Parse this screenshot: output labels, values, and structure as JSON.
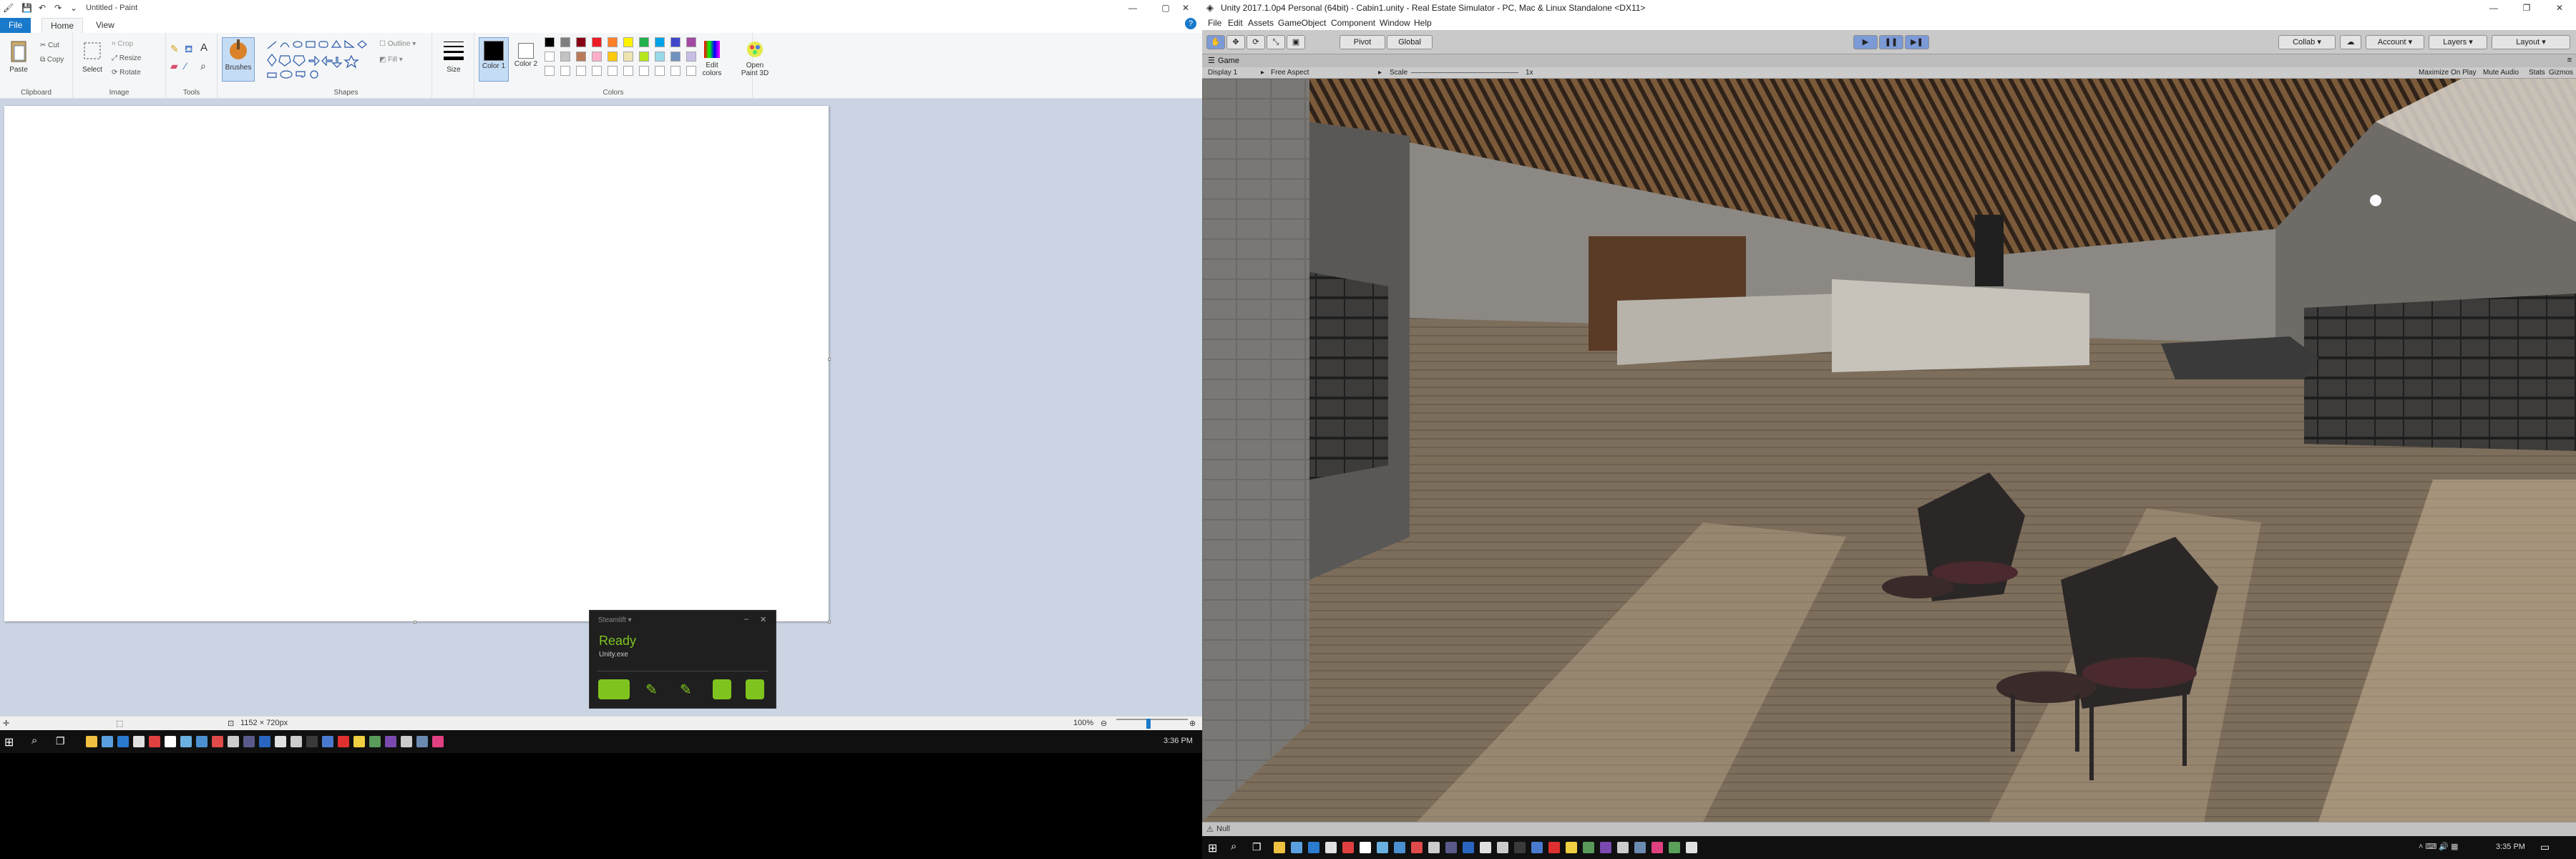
{
  "paint": {
    "title": "Untitled - Paint",
    "tabs": [
      "File",
      "Home",
      "View"
    ],
    "clipboard": {
      "paste": "Paste",
      "cut": "Cut",
      "copy": "Copy",
      "group": "Clipboard"
    },
    "image": {
      "select": "Select",
      "crop": "Crop",
      "resize": "Resize",
      "rotate": "Rotate",
      "group": "Image"
    },
    "tools": {
      "group": "Tools"
    },
    "brushes": {
      "label": "Brushes"
    },
    "shapes": {
      "outline": "Outline",
      "fill": "Fill",
      "group": "Shapes"
    },
    "size": {
      "label": "Size"
    },
    "colors": {
      "color1": "Color 1",
      "color2": "Color 2",
      "edit": "Edit colors",
      "group": "Colors",
      "row1": [
        "#000000",
        "#7f7f7f",
        "#880015",
        "#ed1c24",
        "#ff7f27",
        "#fff200",
        "#22b14c",
        "#00a2e8",
        "#3f48cc",
        "#a349a4"
      ],
      "row2": [
        "#ffffff",
        "#c3c3c3",
        "#b97a57",
        "#ffaec9",
        "#ffc90e",
        "#efe4b0",
        "#b5e61d",
        "#99d9ea",
        "#7092be",
        "#c8bfe7"
      ]
    },
    "paint3d": "Open Paint 3D",
    "status": {
      "canvas_size": "1152 × 720px",
      "zoom": "100%"
    }
  },
  "steamlift": {
    "header": "Steamlift ▾",
    "status": "Ready",
    "process": "Unity.exe"
  },
  "taskbar_left": {
    "clock": "3:36 PM"
  },
  "taskbar_right": {
    "clock": "3:35 PM"
  },
  "unity": {
    "title": "Unity 2017.1.0p4 Personal (64bit) - Cabin1.unity - Real Estate Simulator - PC, Mac & Linux Standalone <DX11>",
    "menu": [
      "File",
      "Edit",
      "Assets",
      "GameObject",
      "Component",
      "Window",
      "Help"
    ],
    "toolbar": {
      "pivot": "Pivot",
      "global": "Global",
      "collab": "Collab ▾",
      "account": "Account ▾",
      "layers": "Layers ▾",
      "layout": "Layout ▾"
    },
    "game_tab": "Game",
    "gamebar": {
      "display": "Display 1",
      "aspect": "Free Aspect",
      "scale_label": "Scale",
      "scale_value": "1x",
      "maximize": "Maximize On Play",
      "mute": "Mute Audio",
      "stats": "Stats",
      "gizmos": "Gizmos ▾"
    },
    "status_text": "Null"
  },
  "colors": {
    "accent_blue": "#1979ca",
    "steamlift_green": "#7fc41e"
  }
}
